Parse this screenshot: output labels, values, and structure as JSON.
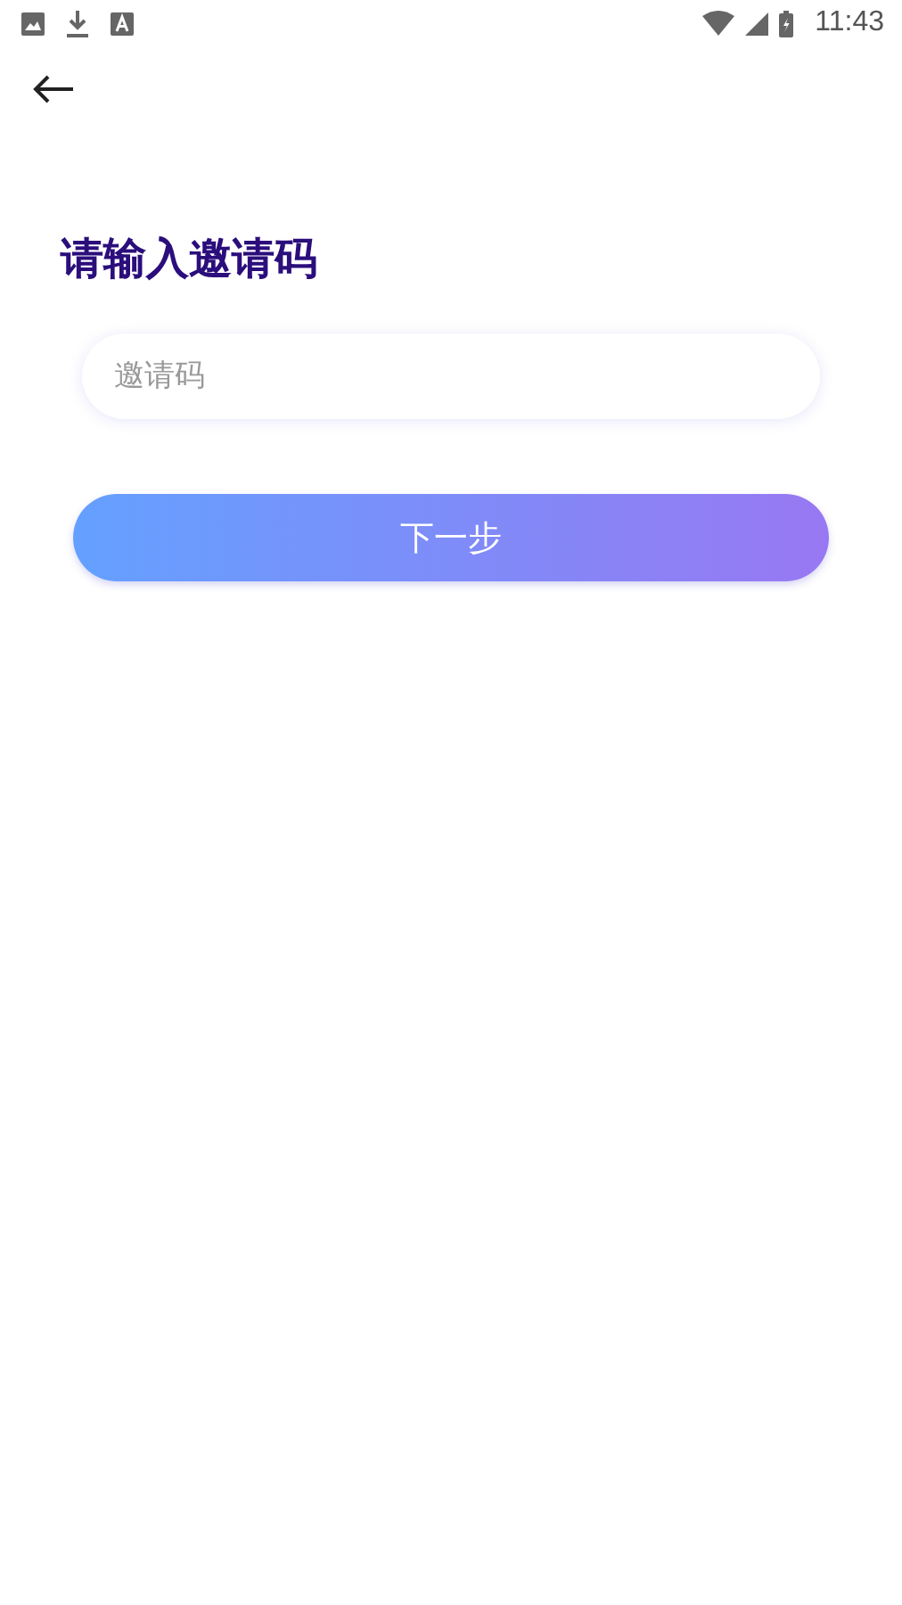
{
  "status_bar": {
    "time": "11:43"
  },
  "title": "请输入邀请码",
  "invite_field": {
    "placeholder": "邀请码"
  },
  "next_button": {
    "label": "下一步"
  }
}
